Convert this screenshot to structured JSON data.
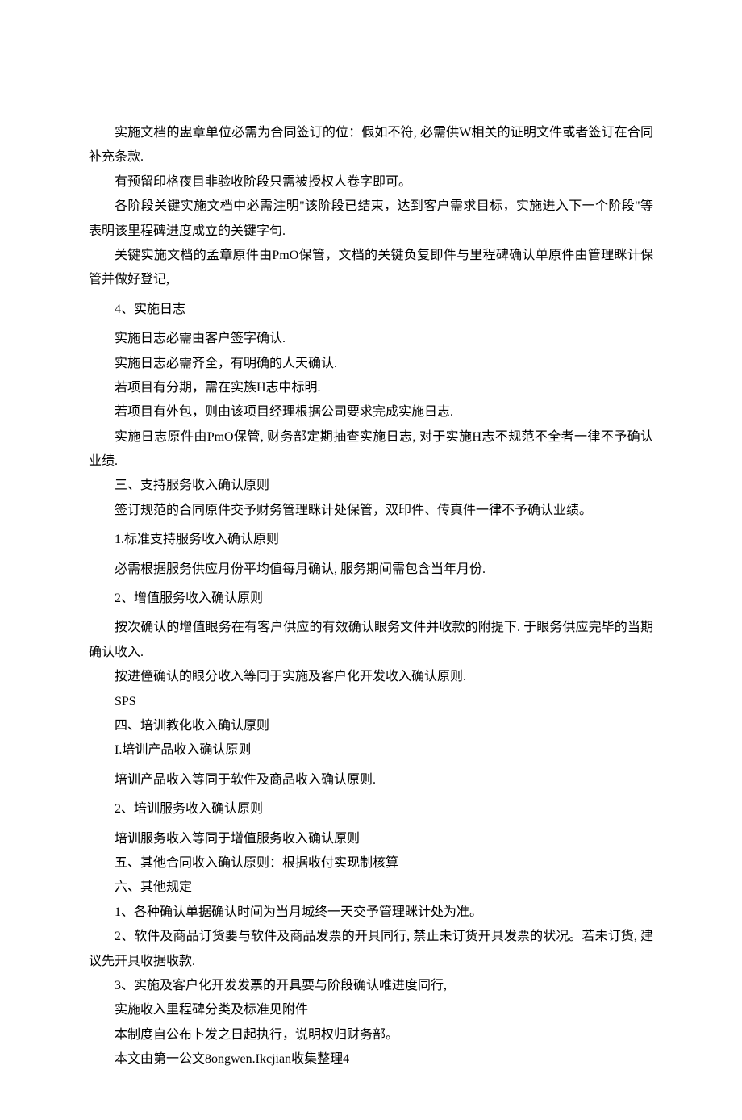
{
  "paragraphs": {
    "p1": "实施文档的盅章单位必需为合同签订的位：假如不符, 必需供W相关的证明文件或者签订在合同补充条款.",
    "p2": "有预留印格夜目非验收阶段只需被授权人卷字即可。",
    "p3": "各阶段关键实施文档中必需注明\"该阶段已结束，达到客户需求目标，实施进入下一个阶段\"等表明该里程碑进度成立的关键字句.",
    "p4": "关键实施文档的孟章原件由PmO保管，文档的关键负复即件与里程碑确认单原件由管理眯计保管并做好登记,",
    "p5": "4、实施日志",
    "p6": "实施日志必需由客户签字确认.",
    "p7": "实施日志必需齐全，有明确的人天确认.",
    "p8": "若项目有分期，需在实族H志中标明.",
    "p9": "若项目有外包，则由该项目经理根据公司要求完成实施日志.",
    "p10": "实施日志原件由PmO保管, 财务部定期抽查实施日志, 对于实施H志不规范不全者一律不予确认业绩.",
    "p11": "三、支持服务收入确认原则",
    "p12": "签订规范的合同原件交予财务管理眯计处保管，双印件、传真件一律不予确认业绩。",
    "p13": "1.标准支持服务收入确认原则",
    "p14": "必需根据服务供应月份平均值每月确认, 服务期间需包含当年月份.",
    "p15": "2、增值服务收入确认原则",
    "p16": "按次确认的增值眼务在有客户供应的有效确认眼务文件并收款的附提下. 于眼务供应完毕的当期确认收入.",
    "p17": "按进僮确认的眼分收入等同于实施及客户化开发收入确认原则.",
    "p18": "SPS",
    "p19": "四、培训教化收入确认原则",
    "p20": "I.培训产品收入确认原则",
    "p21": "培训产品收入等同于软件及商品收入确认原则.",
    "p22": "2、培训服务收入确认原则",
    "p23": "培训服务收入等同于增值服务收入确认原则",
    "p24": "五、其他合同收入确认原则：根据收付实现制核算",
    "p25": "六、其他规定",
    "p26": "1、各种确认单据确认时间为当月城终一天交予管理眯计处为准。",
    "p27": "2、软件及商品订货要与软件及商品发票的开具同行, 禁止未订货开具发票的状况。若未订货, 建议先开具收据收款.",
    "p28": "3、实施及客户化开发发票的开具要与阶段确认唯进度同行,",
    "p29": "实施收入里程碑分类及标准见附件",
    "p30": "本制度自公布卜发之日起执行，说明权归财务部。",
    "p31": "本文由第一公文8ongwen.Ikcjian收集整理4"
  }
}
